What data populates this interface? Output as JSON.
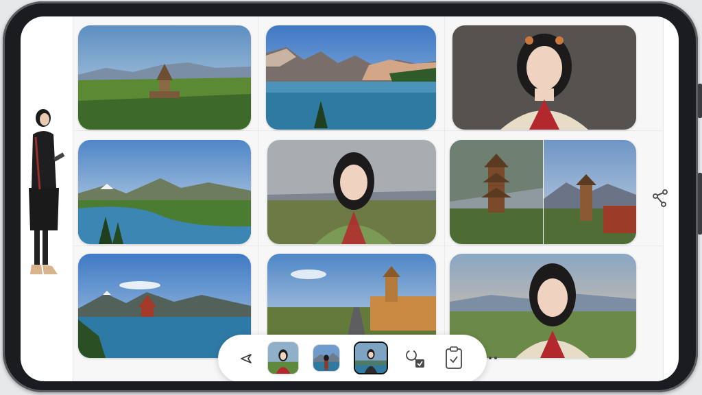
{
  "gallery": {
    "tiles": [
      {
        "subject": "temple-meadow-mountains"
      },
      {
        "subject": "mountain-lake-reflection"
      },
      {
        "subject": "woman-portrait-hands-under-chin"
      },
      {
        "subject": "river-valley-mountains"
      },
      {
        "subject": "woman-portrait-grassland"
      },
      {
        "subject": "pagoda-collage"
      },
      {
        "subject": "lake-temple-mountains"
      },
      {
        "subject": "railway-palace"
      },
      {
        "subject": "woman-portrait-sunset"
      }
    ]
  },
  "toolbar": {
    "items": [
      {
        "icon": "send-icon"
      },
      {
        "icon": "thumbnail-portrait"
      },
      {
        "icon": "thumbnail-person-lake"
      },
      {
        "icon": "thumbnail-selected-woman"
      },
      {
        "icon": "search-check-icon"
      },
      {
        "icon": "clipboard-icon"
      },
      {
        "icon": "more-icon"
      }
    ],
    "selected_index": 3
  },
  "side": {
    "icon": "share-icon"
  },
  "colors": {
    "frame": "#1a1c1f",
    "screen": "#ffffff",
    "sky": "#7fa8cf",
    "grass": "#3f6b2e",
    "lake": "#2f7aa0",
    "accent_red": "#b3282d"
  }
}
